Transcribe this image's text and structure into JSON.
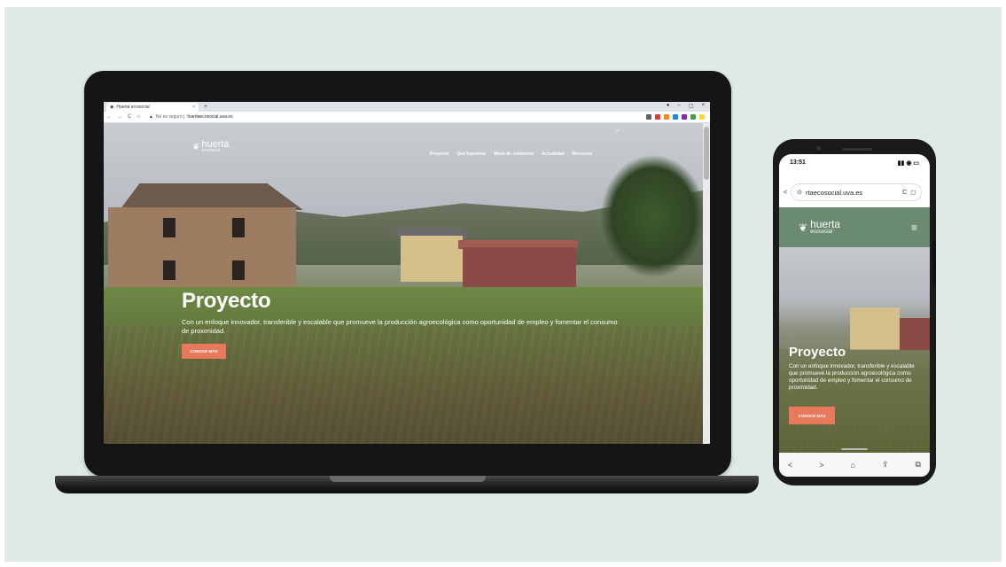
{
  "laptop": {
    "browser": {
      "tab_title": "Huerta ecosocial",
      "tab_close": "×",
      "new_tab": "+",
      "security_text": "No es seguro",
      "url": "huertaecosocial.uva.es",
      "nav_back": "←",
      "nav_forward": "→",
      "nav_reload": "C",
      "nav_home": "⌂",
      "warn_icon": "▲",
      "window_controls": [
        "●",
        "–",
        "▢",
        "×"
      ],
      "extension_colors": [
        "#5f6368",
        "#e53935",
        "#fb8c00",
        "#1e88e5",
        "#8e24aa",
        "#43a047",
        "#fdd835"
      ]
    },
    "site": {
      "logo_word": "huerta",
      "logo_sub": "ecosocial",
      "nav": [
        "Proyecto",
        "Qué hacemos",
        "Mesa de contactos",
        "Actualidad",
        "Recursos"
      ],
      "search_icon": "⌕",
      "hero_title": "Proyecto",
      "hero_text": "Con un enfoque innovador, transferible y escalable que promueve la producción agroecológica como oportunidad de empleo y fomentar el consumo de proximidad.",
      "hero_button": "CONOCE MÁS"
    }
  },
  "phone": {
    "status_time": "13:51",
    "status_icons": "▮▮ ◉ ▭",
    "back": "<",
    "site_info_icon": "⊙",
    "url": "rtaecosocial.uva.es",
    "reload": "C",
    "bookmark": "◻",
    "logo_word": "huerta",
    "logo_sub": "ecosocial",
    "menu_icon": "≡",
    "hero_title": "Proyecto",
    "hero_text": "Con un enfoque innovador, transferible y escalable que promueve la producción agroecológica como oportunidad de empleo y fomentar el consumo de proximidad.",
    "hero_button": "CONOCE MÁS",
    "bottom_bar": [
      "<",
      ">",
      "⌂",
      "⇪",
      "⧉"
    ]
  },
  "colors": {
    "background": "#dfeae5",
    "phone_header": "#6b8a72",
    "accent_button": "#e8795b"
  }
}
